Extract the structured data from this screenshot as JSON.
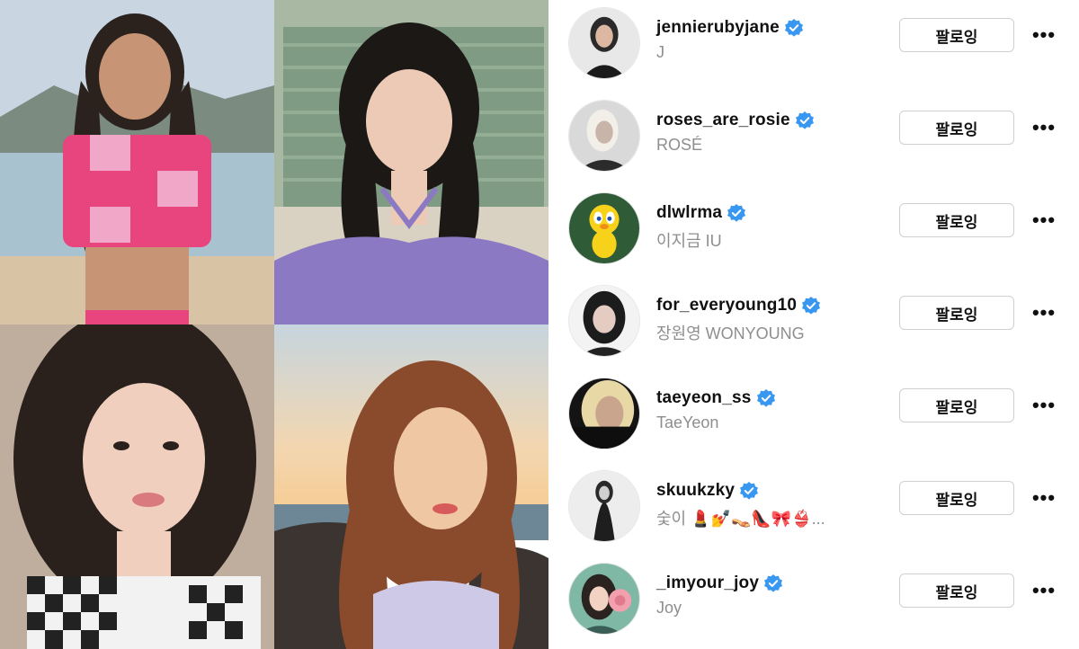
{
  "collage": {
    "photos": [
      {
        "name": "photo-beach-pink-top"
      },
      {
        "name": "photo-purple-halter"
      },
      {
        "name": "photo-checkered-top"
      },
      {
        "name": "photo-sunset-seaside"
      }
    ]
  },
  "accounts": [
    {
      "username": "jennierubyjane",
      "display_name": "J",
      "follow_label": "팔로잉",
      "more": "•••",
      "verified_icon": "verified-badge-icon"
    },
    {
      "username": "roses_are_rosie",
      "display_name": "ROSÉ",
      "follow_label": "팔로잉",
      "more": "•••",
      "verified_icon": "verified-badge-icon"
    },
    {
      "username": "dlwlrma",
      "display_name": "이지금 IU",
      "follow_label": "팔로잉",
      "more": "•••",
      "verified_icon": "verified-badge-icon"
    },
    {
      "username": "for_everyoung10",
      "display_name": "장원영 WONYOUNG",
      "follow_label": "팔로잉",
      "more": "•••",
      "verified_icon": "verified-badge-icon"
    },
    {
      "username": "taeyeon_ss",
      "display_name": "TaeYeon",
      "follow_label": "팔로잉",
      "more": "•••",
      "verified_icon": "verified-badge-icon"
    },
    {
      "username": "skuukzky",
      "display_name": "숯이 💄💅👡👠🎀👙...",
      "follow_label": "팔로잉",
      "more": "•••",
      "verified_icon": "verified-badge-icon"
    },
    {
      "username": "_imyour_joy",
      "display_name": "Joy",
      "follow_label": "팔로잉",
      "more": "•••",
      "verified_icon": "verified-badge-icon"
    }
  ],
  "colors": {
    "verified": "#3897f0",
    "subtext": "#8e8e8e",
    "border": "#cfcfcf"
  }
}
